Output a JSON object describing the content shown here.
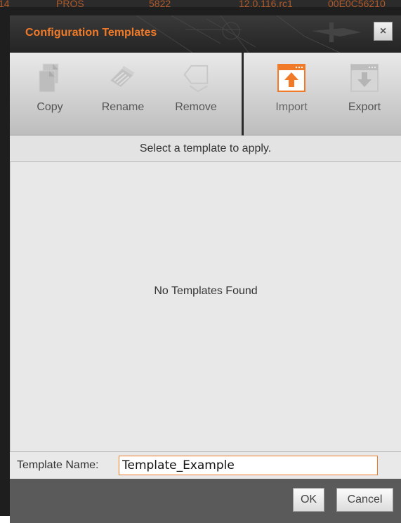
{
  "background": {
    "strip_texts": [
      "14",
      "PROS",
      "5822",
      "12.0.116.rc1",
      "00E0C56210"
    ]
  },
  "dialog": {
    "title": "Configuration Templates",
    "close_glyph": "×",
    "accent_color": "#f07a28"
  },
  "toolbar": {
    "items": [
      {
        "label": "Copy",
        "icon": "copy-icon",
        "enabled": false
      },
      {
        "label": "Rename",
        "icon": "rename-icon",
        "enabled": false
      },
      {
        "label": "Remove",
        "icon": "remove-icon",
        "enabled": false
      },
      {
        "label": "Import",
        "icon": "import-icon",
        "enabled": true
      },
      {
        "label": "Export",
        "icon": "export-icon",
        "enabled": false
      }
    ]
  },
  "hint": "Select a template to apply.",
  "list": {
    "empty_message": "No Templates Found"
  },
  "name_field": {
    "label": "Template Name:",
    "value": "Template_Example"
  },
  "footer": {
    "ok_label": "OK",
    "cancel_label": "Cancel"
  }
}
